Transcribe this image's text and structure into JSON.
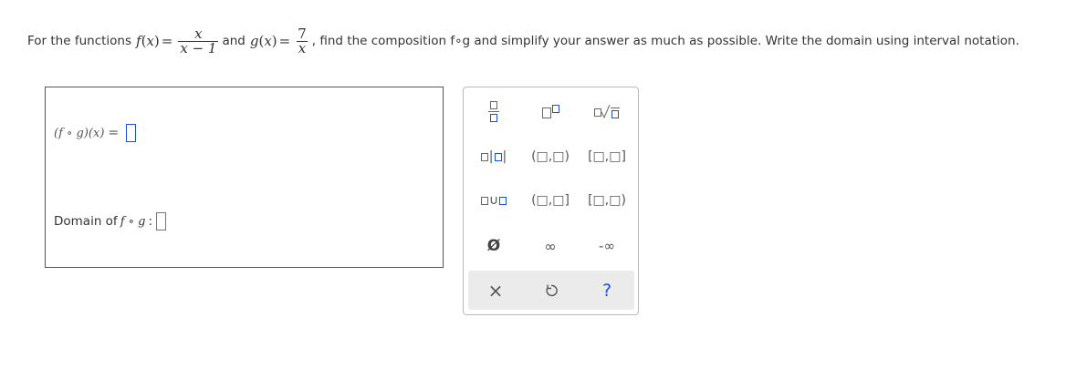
{
  "question": {
    "text_prefix": "For the functions",
    "f_label": "f",
    "var_x": "x",
    "f_num": "x",
    "f_den": "x − 1",
    "and_text": "and",
    "g_label": "g",
    "g_num": "7",
    "g_den": "x",
    "text_suffix": ", find the composition f∘g and simplify your answer as much as possible. Write the domain using interval notation."
  },
  "answer": {
    "composition_label": "(f ∘ g)(x)",
    "equals": "=",
    "domain_label": "Domain of",
    "domain_expr": "f ∘ g",
    "colon": ":"
  },
  "palette": {
    "interval_open": "(□,□)",
    "interval_closed": "[□,□]",
    "interval_half_right_closed": "(□,□]",
    "interval_half_left_closed": "[□,□)",
    "empty_set": "Ø",
    "infinity": "∞",
    "neg_infinity": "-∞",
    "clear": "×",
    "help": "?"
  },
  "colors": {
    "blank_border": "#1a4fd8",
    "help": "#1a4fd8"
  }
}
